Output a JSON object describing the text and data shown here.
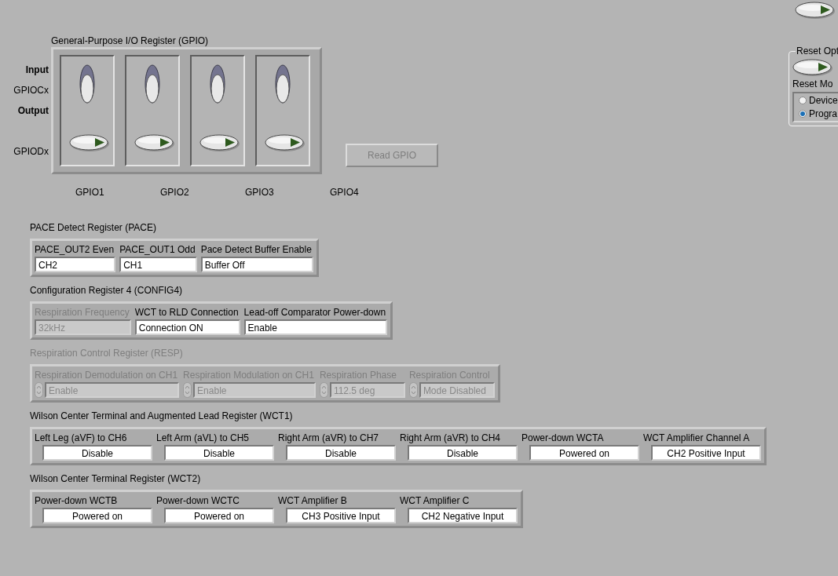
{
  "gpio": {
    "title": "General-Purpose I/O Register (GPIO)",
    "row_labels": [
      {
        "text": "Input",
        "kind": "state"
      },
      {
        "text": "GPIOCx",
        "kind": "signal"
      },
      {
        "text": "Output",
        "kind": "state"
      },
      {
        "text": "GPIODx",
        "kind": "signal"
      }
    ],
    "channels": [
      {
        "label": "GPIO1",
        "direction_on": false,
        "data_on": false
      },
      {
        "label": "GPIO2",
        "direction_on": false,
        "data_on": false
      },
      {
        "label": "GPIO3",
        "direction_on": false,
        "data_on": false
      },
      {
        "label": "GPIO4",
        "direction_on": false,
        "data_on": false
      }
    ],
    "read_button": {
      "label": "Read GPIO",
      "disabled": true
    }
  },
  "reset_panel": {
    "toggle_on": false,
    "group_title": "Reset Opt",
    "reset_toggle_on": false,
    "mode_label": "Reset Mo",
    "modes": [
      {
        "label": "Device",
        "selected": false
      },
      {
        "label": "Progra",
        "selected": true
      }
    ]
  },
  "registers": [
    {
      "title": "PACE Detect Register (PACE)",
      "kind": "plain",
      "disabled": false,
      "fields": [
        {
          "label": "PACE_OUT2 Even",
          "value": "CH2",
          "disabled": false
        },
        {
          "label": "PACE_OUT1 Odd",
          "value": "CH1",
          "disabled": false
        },
        {
          "label": "Pace Detect Buffer Enable",
          "value": "Buffer Off",
          "disabled": false
        }
      ]
    },
    {
      "title": "Configuration Register 4 (CONFIG4)",
      "kind": "plain",
      "disabled": false,
      "fields": [
        {
          "label": "Respiration Frequency",
          "value": "32kHz",
          "disabled": true
        },
        {
          "label": "WCT to RLD Connection",
          "value": "Connection ON",
          "disabled": false
        },
        {
          "label": "Lead-off Comparator Power-down",
          "value": "Enable",
          "disabled": false
        }
      ]
    },
    {
      "title": "Respiration Control Register (RESP)",
      "kind": "spin",
      "disabled": true,
      "fields": [
        {
          "label": "Respiration Demodulation on CH1",
          "value": "Enable",
          "disabled": true
        },
        {
          "label": "Respiration Modulation on CH1",
          "value": "Enable",
          "disabled": true
        },
        {
          "label": "Respiration Phase",
          "value": "112.5 deg",
          "disabled": true
        },
        {
          "label": "Respiration Control",
          "value": "Mode Disabled",
          "disabled": true
        }
      ]
    },
    {
      "title": "Wilson Center Terminal and Augmented Lead Register (WCT1)",
      "kind": "centered",
      "disabled": false,
      "fields": [
        {
          "label": "Left Leg (aVF) to CH6",
          "value": "Disable",
          "disabled": false
        },
        {
          "label": "Left Arm (aVL) to CH5",
          "value": "Disable",
          "disabled": false
        },
        {
          "label": "Right Arm (aVR) to CH7",
          "value": "Disable",
          "disabled": false
        },
        {
          "label": "Right Arm (aVR) to CH4",
          "value": "Disable",
          "disabled": false
        },
        {
          "label": "Power-down WCTA",
          "value": "Powered on",
          "disabled": false
        },
        {
          "label": "WCT Amplifier Channel A",
          "value": "CH2 Positive Input",
          "disabled": false
        }
      ]
    },
    {
      "title": "Wilson Center Terminal Register (WCT2)",
      "kind": "centered",
      "disabled": false,
      "fields": [
        {
          "label": "Power-down WCTB",
          "value": "Powered on",
          "disabled": false
        },
        {
          "label": "Power-down WCTC",
          "value": "Powered on",
          "disabled": false
        },
        {
          "label": "WCT Amplifier B",
          "value": "CH3 Positive Input",
          "disabled": false
        },
        {
          "label": "WCT Amplifier C",
          "value": "CH2 Negative Input",
          "disabled": false
        }
      ]
    }
  ]
}
